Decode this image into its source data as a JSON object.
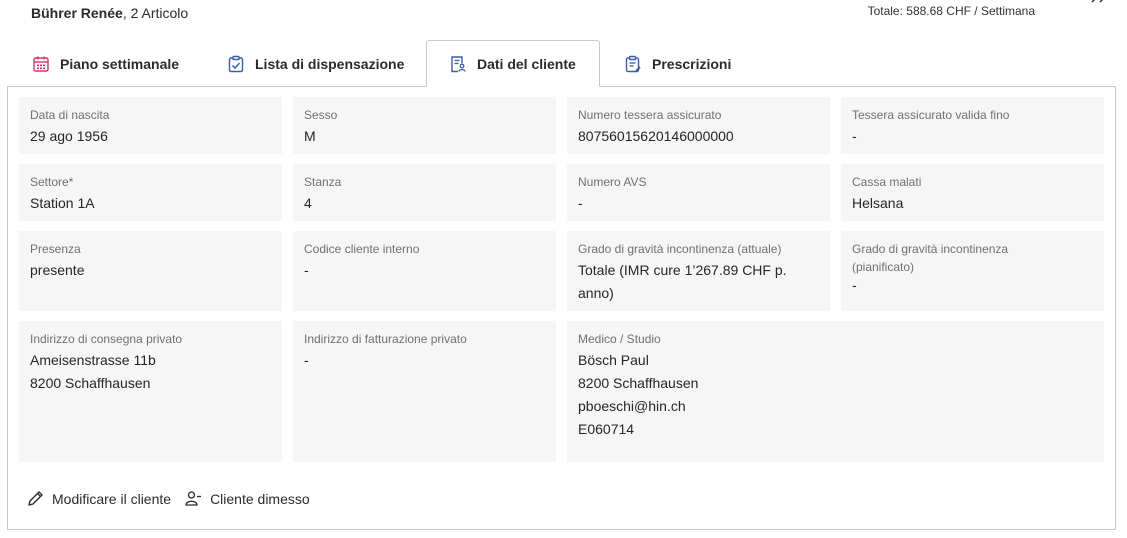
{
  "header": {
    "client_name": "Bührer Renée",
    "client_suffix": ", 2 Articolo",
    "total": "Totale: 588.68 CHF / Settimana"
  },
  "tabs": [
    {
      "label": "Piano settimanale",
      "icon": "calendar-icon"
    },
    {
      "label": "Lista di dispensazione",
      "icon": "clipboard-check-icon"
    },
    {
      "label": "Dati del cliente",
      "icon": "client-data-icon"
    },
    {
      "label": "Prescrizioni",
      "icon": "prescription-icon"
    }
  ],
  "fields": {
    "birth_date": {
      "label": "Data di nascita",
      "value": "29 ago 1956"
    },
    "gender": {
      "label": "Sesso",
      "value": "M"
    },
    "insurance_card": {
      "label": "Numero tessera assicurato",
      "value": "80756015620146000000"
    },
    "insurance_valid": {
      "label": "Tessera assicurato valida fino",
      "value": "-"
    },
    "sector": {
      "label": "Settore*",
      "value": "Station 1A"
    },
    "room": {
      "label": "Stanza",
      "value": "4"
    },
    "avs": {
      "label": "Numero AVS",
      "value": "-"
    },
    "health_insurance": {
      "label": "Cassa malati",
      "value": "Helsana"
    },
    "presence": {
      "label": "Presenza",
      "value": "presente"
    },
    "internal_code": {
      "label": "Codice cliente interno",
      "value": "-"
    },
    "incontinence_current": {
      "label": "Grado di gravità incontinenza (attuale)",
      "value_line1": "Totale (IMR cure 1’267.89 CHF p.",
      "value_line2": "anno)"
    },
    "incontinence_planned": {
      "label": "Grado di gravità incontinenza (pianificato)",
      "value": "-"
    },
    "delivery_address": {
      "label": "Indirizzo di consegna privato",
      "lines": [
        "Ameisenstrasse 11b",
        "8200 Schaffhausen"
      ]
    },
    "billing_address": {
      "label": "Indirizzo di fatturazione privato",
      "value": "-"
    },
    "doctor": {
      "label": "Medico / Studio",
      "lines": [
        "Bösch Paul",
        "8200 Schaffhausen",
        "pboeschi@hin.ch",
        "E060714"
      ]
    }
  },
  "footer": {
    "edit_label": "Modificare il cliente",
    "discharge_label": "Cliente dimesso"
  },
  "colors": {
    "accent_pink": "#d6336c",
    "accent_blue": "#3a5da8",
    "card_bg": "#f6f6f6"
  }
}
